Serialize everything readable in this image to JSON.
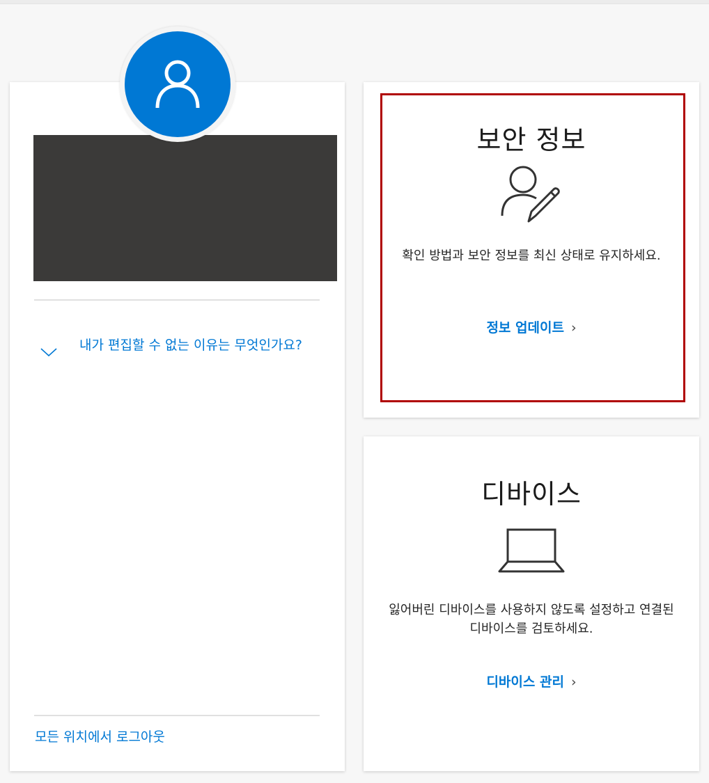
{
  "profile": {
    "why_cant_edit_label": "내가 편집할 수 없는 이유는 무엇인가요?",
    "sign_out_everywhere_label": "모든 위치에서 로그아웃"
  },
  "security_info": {
    "title": "보안 정보",
    "description": "확인 방법과 보안 정보를 최신 상태로 유지하세요.",
    "link_label": "정보 업데이트",
    "link_arrow": "›"
  },
  "devices": {
    "title": "디바이스",
    "description": "잃어버린 디바이스를 사용하지 않도록 설정하고 연결된 디바이스를 검토하세요.",
    "link_label": "디바이스 관리",
    "link_arrow": "›"
  },
  "colors": {
    "accent": "#0078d4",
    "highlight_border": "#b00000",
    "redacted_block": "#3b3a39"
  },
  "icons": {
    "avatar": "person-icon",
    "security": "person-edit-icon",
    "devices": "laptop-icon",
    "expand": "chevron-down-icon"
  }
}
